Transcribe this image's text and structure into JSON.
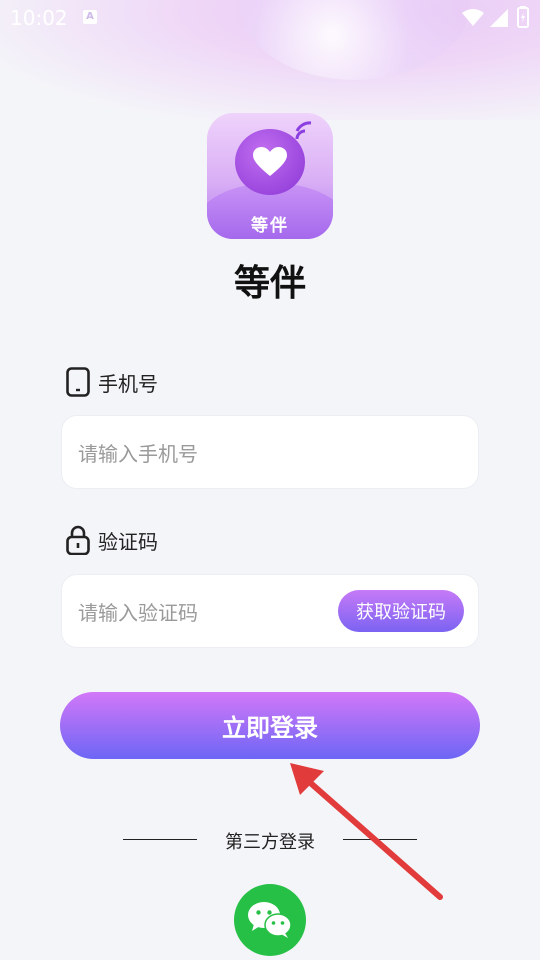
{
  "status_bar": {
    "time": "10:02",
    "icons": [
      "a-icon",
      "wifi-icon",
      "signal-icon",
      "battery-icon"
    ]
  },
  "app": {
    "logo_text": "等伴",
    "name": "等伴"
  },
  "phone": {
    "label": "手机号",
    "placeholder": "请输入手机号",
    "value": ""
  },
  "code": {
    "label": "验证码",
    "placeholder": "请输入验证码",
    "value": "",
    "get_code_label": "获取验证码"
  },
  "login_label": "立即登录",
  "third_party": {
    "label": "第三方登录",
    "providers": [
      "wechat-icon"
    ]
  },
  "colors": {
    "accent_start": "#d278f8",
    "accent_end": "#6d66f5",
    "wechat": "#27c046",
    "annotation_arrow": "#e23b3b"
  }
}
